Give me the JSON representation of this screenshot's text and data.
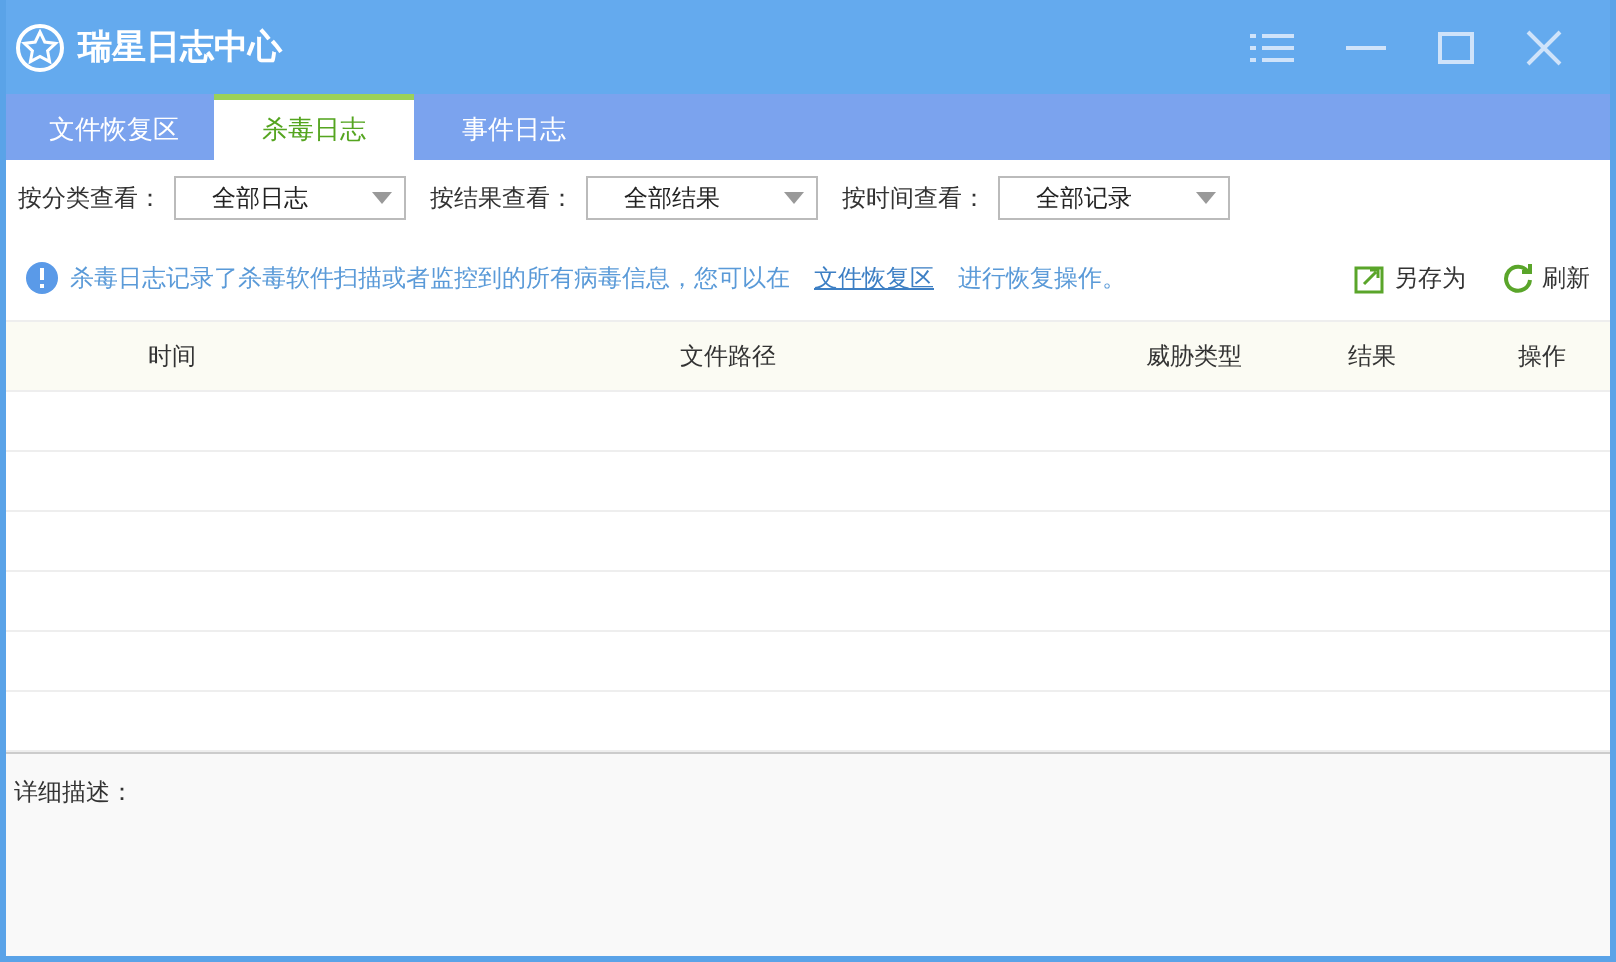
{
  "window": {
    "title": "瑞星日志中心"
  },
  "tabs": [
    {
      "label": "文件恢复区",
      "selected": false
    },
    {
      "label": "杀毒日志",
      "selected": true
    },
    {
      "label": "事件日志",
      "selected": false
    }
  ],
  "filters": [
    {
      "label": "按分类查看：",
      "value": "全部日志"
    },
    {
      "label": "按结果查看：",
      "value": "全部结果"
    },
    {
      "label": "按时间查看：",
      "value": "全部记录"
    }
  ],
  "info": {
    "text": "杀毒日志记录了杀毒软件扫描或者监控到的所有病毒信息，您可以在",
    "link": "文件恢复区",
    "after": "进行恢复操作。"
  },
  "actions": [
    {
      "kind": "save",
      "label": "另存为"
    },
    {
      "kind": "refresh",
      "label": "刷新"
    }
  ],
  "table": {
    "columns": [
      "时间",
      "文件路径",
      "威胁类型",
      "结果",
      "操作"
    ]
  },
  "details": {
    "label": "详细描述："
  }
}
